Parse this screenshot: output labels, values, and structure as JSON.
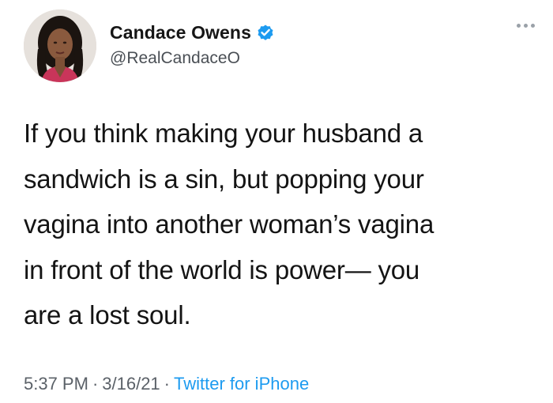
{
  "author": {
    "display_name": "Candace Owens",
    "handle": "@RealCandaceO",
    "verified": true
  },
  "icons": {
    "verified": "verified-badge-icon",
    "more": "more-options-icon"
  },
  "tweet": {
    "text_lines": [
      "If you think making your husband a",
      "sandwich is a sin, but popping your",
      "vagina into another woman’s vagina",
      "in front of the world is power— you",
      "are a lost soul."
    ]
  },
  "meta": {
    "time": "5:37 PM",
    "separator": "·",
    "date": "3/16/21",
    "source": "Twitter for iPhone"
  },
  "colors": {
    "verified_blue": "#1d9bf0",
    "source_link": "#1d9bf0",
    "meta_gray": "#5b6168"
  }
}
